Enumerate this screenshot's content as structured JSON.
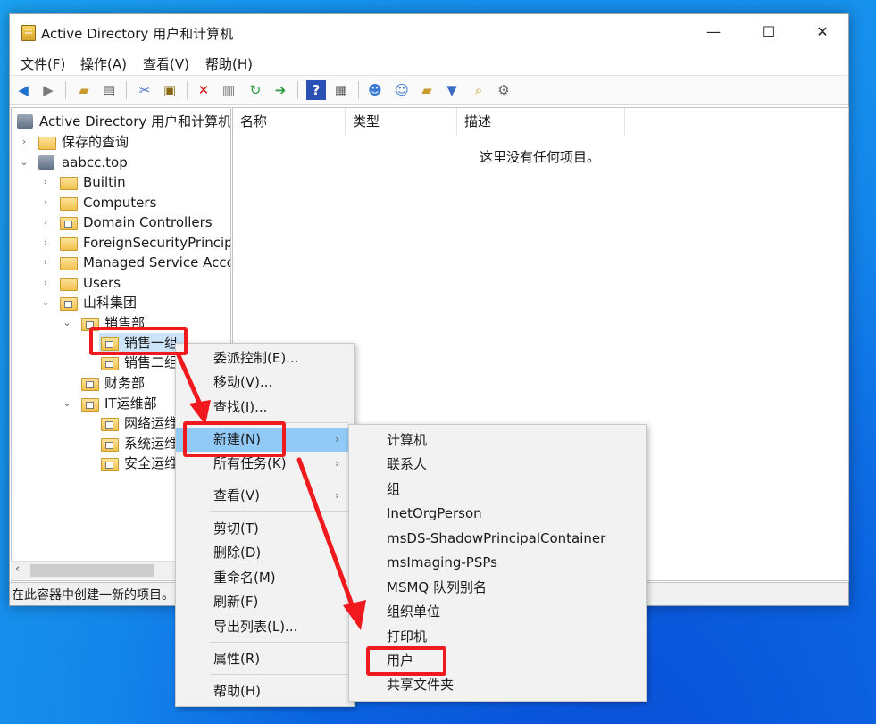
{
  "window": {
    "title": "Active Directory 用户和计算机",
    "minimize": "—",
    "maximize": "☐",
    "close": "✕"
  },
  "menubar": [
    "文件(F)",
    "操作(A)",
    "查看(V)",
    "帮助(H)"
  ],
  "toolbar_icons": [
    "back-icon",
    "forward-icon",
    "up-folder-icon",
    "show-tree-icon",
    "cut-icon",
    "paste-icon",
    "delete-icon",
    "properties-icon",
    "refresh-icon",
    "export-icon",
    "help-icon",
    "console-icon",
    "new-user-icon",
    "new-group-icon",
    "new-ou-icon",
    "filter-icon",
    "find-icon",
    "delegate-icon"
  ],
  "tree": {
    "root": "Active Directory 用户和计算机 [",
    "saved_queries": "保存的查询",
    "domain": "aabcc.top",
    "builtin": "Builtin",
    "computers": "Computers",
    "domain_controllers": "Domain Controllers",
    "foreign": "ForeignSecurityPrincipal",
    "managed": "Managed Service Accou",
    "users": "Users",
    "group": "山科集团",
    "sales": "销售部",
    "sales1": "销售一组",
    "sales2": "销售二组",
    "finance": "财务部",
    "it": "IT运维部",
    "network": "网络运维",
    "system": "系统运维",
    "security": "安全运维"
  },
  "columns": [
    "名称",
    "类型",
    "描述"
  ],
  "empty_message": "这里没有任何项目。",
  "status": "在此容器中创建一新的项目。",
  "context_menu": {
    "delegate": "委派控制(E)...",
    "move": "移动(V)...",
    "find": "查找(I)...",
    "new": "新建(N)",
    "all_tasks": "所有任务(K)",
    "view": "查看(V)",
    "cut": "剪切(T)",
    "delete": "删除(D)",
    "rename": "重命名(M)",
    "refresh": "刷新(F)",
    "export": "导出列表(L)...",
    "properties": "属性(R)",
    "help": "帮助(H)",
    "submenu_arrow": "›"
  },
  "new_submenu": [
    "计算机",
    "联系人",
    "组",
    "InetOrgPerson",
    "msDS-ShadowPrincipalContainer",
    "msImaging-PSPs",
    "MSMQ 队列别名",
    "组织单位",
    "打印机",
    "用户",
    "共享文件夹"
  ],
  "colors": {
    "highlight": "#91c9f7",
    "annotation_red": "#f0191d",
    "desktop_blue": "#0b63e0"
  }
}
